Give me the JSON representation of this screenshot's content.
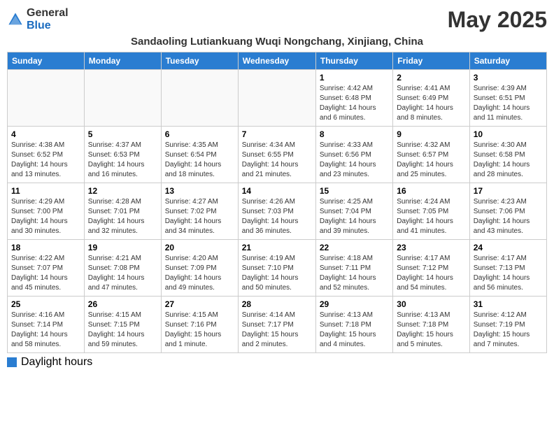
{
  "header": {
    "logo_general": "General",
    "logo_blue": "Blue",
    "month_title": "May 2025",
    "location": "Sandaoling Lutiankuang Wuqi Nongchang, Xinjiang, China"
  },
  "weekdays": [
    "Sunday",
    "Monday",
    "Tuesday",
    "Wednesday",
    "Thursday",
    "Friday",
    "Saturday"
  ],
  "weeks": [
    [
      {
        "day": "",
        "info": ""
      },
      {
        "day": "",
        "info": ""
      },
      {
        "day": "",
        "info": ""
      },
      {
        "day": "",
        "info": ""
      },
      {
        "day": "1",
        "info": "Sunrise: 4:42 AM\nSunset: 6:48 PM\nDaylight: 14 hours\nand 6 minutes."
      },
      {
        "day": "2",
        "info": "Sunrise: 4:41 AM\nSunset: 6:49 PM\nDaylight: 14 hours\nand 8 minutes."
      },
      {
        "day": "3",
        "info": "Sunrise: 4:39 AM\nSunset: 6:51 PM\nDaylight: 14 hours\nand 11 minutes."
      }
    ],
    [
      {
        "day": "4",
        "info": "Sunrise: 4:38 AM\nSunset: 6:52 PM\nDaylight: 14 hours\nand 13 minutes."
      },
      {
        "day": "5",
        "info": "Sunrise: 4:37 AM\nSunset: 6:53 PM\nDaylight: 14 hours\nand 16 minutes."
      },
      {
        "day": "6",
        "info": "Sunrise: 4:35 AM\nSunset: 6:54 PM\nDaylight: 14 hours\nand 18 minutes."
      },
      {
        "day": "7",
        "info": "Sunrise: 4:34 AM\nSunset: 6:55 PM\nDaylight: 14 hours\nand 21 minutes."
      },
      {
        "day": "8",
        "info": "Sunrise: 4:33 AM\nSunset: 6:56 PM\nDaylight: 14 hours\nand 23 minutes."
      },
      {
        "day": "9",
        "info": "Sunrise: 4:32 AM\nSunset: 6:57 PM\nDaylight: 14 hours\nand 25 minutes."
      },
      {
        "day": "10",
        "info": "Sunrise: 4:30 AM\nSunset: 6:58 PM\nDaylight: 14 hours\nand 28 minutes."
      }
    ],
    [
      {
        "day": "11",
        "info": "Sunrise: 4:29 AM\nSunset: 7:00 PM\nDaylight: 14 hours\nand 30 minutes."
      },
      {
        "day": "12",
        "info": "Sunrise: 4:28 AM\nSunset: 7:01 PM\nDaylight: 14 hours\nand 32 minutes."
      },
      {
        "day": "13",
        "info": "Sunrise: 4:27 AM\nSunset: 7:02 PM\nDaylight: 14 hours\nand 34 minutes."
      },
      {
        "day": "14",
        "info": "Sunrise: 4:26 AM\nSunset: 7:03 PM\nDaylight: 14 hours\nand 36 minutes."
      },
      {
        "day": "15",
        "info": "Sunrise: 4:25 AM\nSunset: 7:04 PM\nDaylight: 14 hours\nand 39 minutes."
      },
      {
        "day": "16",
        "info": "Sunrise: 4:24 AM\nSunset: 7:05 PM\nDaylight: 14 hours\nand 41 minutes."
      },
      {
        "day": "17",
        "info": "Sunrise: 4:23 AM\nSunset: 7:06 PM\nDaylight: 14 hours\nand 43 minutes."
      }
    ],
    [
      {
        "day": "18",
        "info": "Sunrise: 4:22 AM\nSunset: 7:07 PM\nDaylight: 14 hours\nand 45 minutes."
      },
      {
        "day": "19",
        "info": "Sunrise: 4:21 AM\nSunset: 7:08 PM\nDaylight: 14 hours\nand 47 minutes."
      },
      {
        "day": "20",
        "info": "Sunrise: 4:20 AM\nSunset: 7:09 PM\nDaylight: 14 hours\nand 49 minutes."
      },
      {
        "day": "21",
        "info": "Sunrise: 4:19 AM\nSunset: 7:10 PM\nDaylight: 14 hours\nand 50 minutes."
      },
      {
        "day": "22",
        "info": "Sunrise: 4:18 AM\nSunset: 7:11 PM\nDaylight: 14 hours\nand 52 minutes."
      },
      {
        "day": "23",
        "info": "Sunrise: 4:17 AM\nSunset: 7:12 PM\nDaylight: 14 hours\nand 54 minutes."
      },
      {
        "day": "24",
        "info": "Sunrise: 4:17 AM\nSunset: 7:13 PM\nDaylight: 14 hours\nand 56 minutes."
      }
    ],
    [
      {
        "day": "25",
        "info": "Sunrise: 4:16 AM\nSunset: 7:14 PM\nDaylight: 14 hours\nand 58 minutes."
      },
      {
        "day": "26",
        "info": "Sunrise: 4:15 AM\nSunset: 7:15 PM\nDaylight: 14 hours\nand 59 minutes."
      },
      {
        "day": "27",
        "info": "Sunrise: 4:15 AM\nSunset: 7:16 PM\nDaylight: 15 hours\nand 1 minute."
      },
      {
        "day": "28",
        "info": "Sunrise: 4:14 AM\nSunset: 7:17 PM\nDaylight: 15 hours\nand 2 minutes."
      },
      {
        "day": "29",
        "info": "Sunrise: 4:13 AM\nSunset: 7:18 PM\nDaylight: 15 hours\nand 4 minutes."
      },
      {
        "day": "30",
        "info": "Sunrise: 4:13 AM\nSunset: 7:18 PM\nDaylight: 15 hours\nand 5 minutes."
      },
      {
        "day": "31",
        "info": "Sunrise: 4:12 AM\nSunset: 7:19 PM\nDaylight: 15 hours\nand 7 minutes."
      }
    ]
  ],
  "footer": {
    "daylight_label": "Daylight hours"
  }
}
